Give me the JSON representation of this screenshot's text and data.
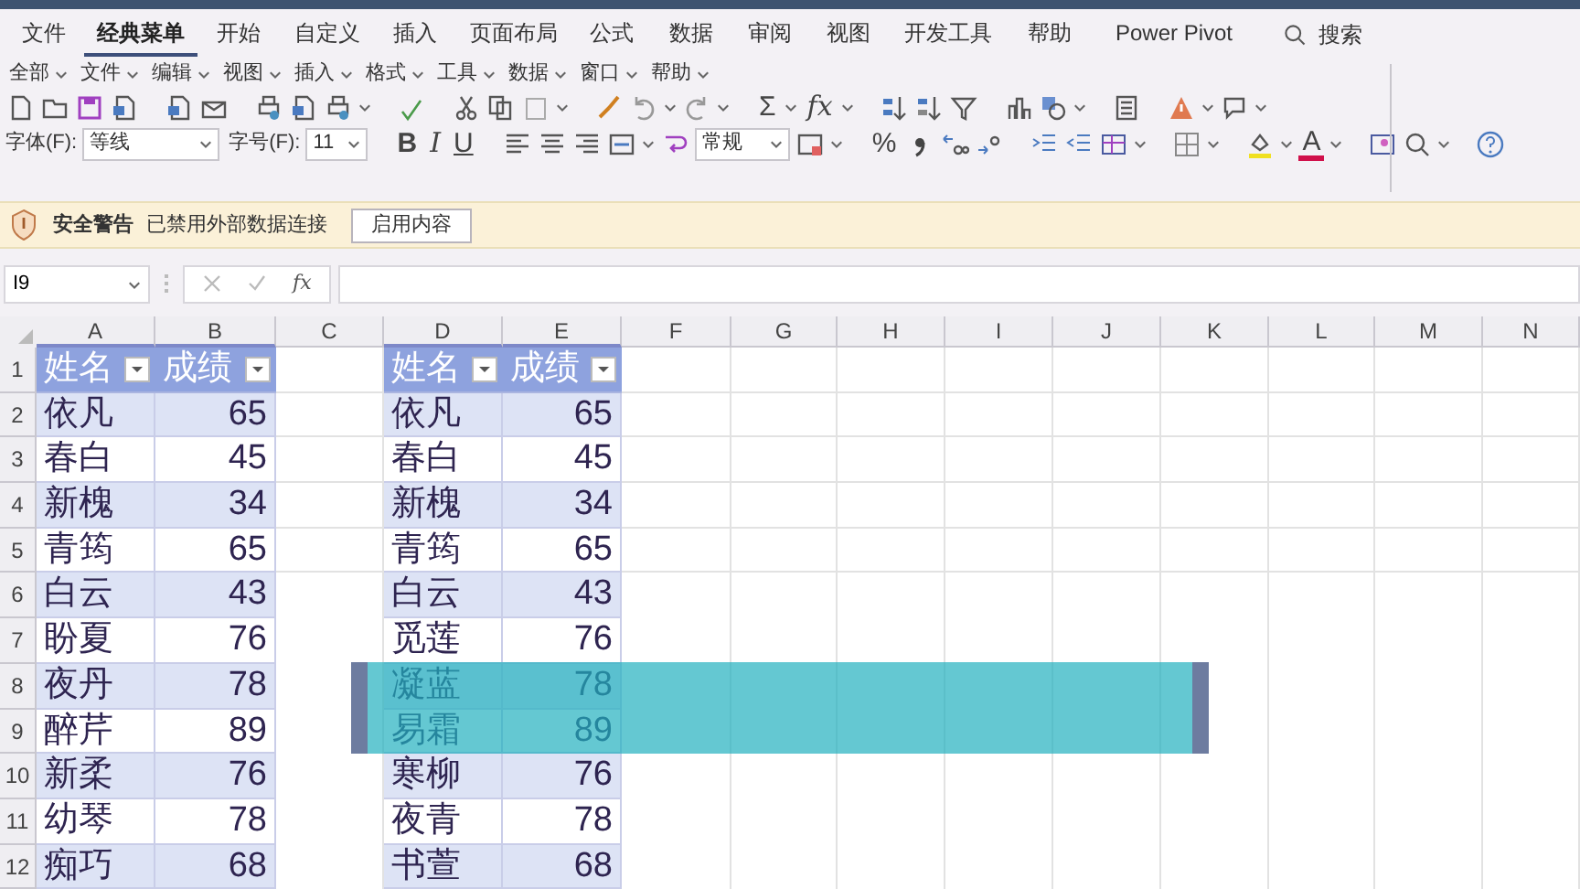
{
  "ribbon_tabs": [
    {
      "label": "文件",
      "selected": false
    },
    {
      "label": "经典菜单",
      "selected": true
    },
    {
      "label": "开始",
      "selected": false
    },
    {
      "label": "自定义",
      "selected": false
    },
    {
      "label": "插入",
      "selected": false
    },
    {
      "label": "页面布局",
      "selected": false
    },
    {
      "label": "公式",
      "selected": false
    },
    {
      "label": "数据",
      "selected": false
    },
    {
      "label": "审阅",
      "selected": false
    },
    {
      "label": "视图",
      "selected": false
    },
    {
      "label": "开发工具",
      "selected": false
    },
    {
      "label": "帮助",
      "selected": false
    },
    {
      "label": "Power Pivot",
      "selected": false
    }
  ],
  "search": {
    "label": "搜索"
  },
  "classic_menu": [
    "全部",
    "文件",
    "编辑",
    "视图",
    "插入",
    "格式",
    "工具",
    "数据",
    "窗口",
    "帮助"
  ],
  "toolbar_texts": {
    "sum": "Σ",
    "function": "fx",
    "bold": "B",
    "italic": "I",
    "underline": "U",
    "percent": "%",
    "font_color": "A"
  },
  "font_row": {
    "font_label": "字体(F):",
    "font": "等线",
    "size_label": "字号(F):",
    "size": "11",
    "number_format": "常规"
  },
  "security_bar": {
    "title": "安全警告",
    "message": "已禁用外部数据连接",
    "button": "启用内容"
  },
  "formula_bar": {
    "name_box": "I9",
    "fx": "fx"
  },
  "sheet": {
    "columns": [
      "A",
      "B",
      "C",
      "D",
      "E",
      "F",
      "G",
      "H",
      "I",
      "J",
      "K",
      "L",
      "M",
      "N"
    ],
    "row_numbers": [
      "1",
      "2",
      "3",
      "4",
      "5",
      "6",
      "7",
      "8",
      "9",
      "10",
      "11",
      "12"
    ]
  },
  "tables": [
    {
      "header": [
        "姓名",
        "成绩"
      ],
      "rows": [
        [
          "依凡",
          "65"
        ],
        [
          "春白",
          "45"
        ],
        [
          "新槐",
          "34"
        ],
        [
          "青筠",
          "65"
        ],
        [
          "白云",
          "43"
        ],
        [
          "盼夏",
          "76"
        ],
        [
          "夜丹",
          "78"
        ],
        [
          "醉芹",
          "89"
        ],
        [
          "新柔",
          "76"
        ],
        [
          "幼琴",
          "78"
        ],
        [
          "痴巧",
          "68"
        ]
      ]
    },
    {
      "header": [
        "姓名",
        "成绩"
      ],
      "rows": [
        [
          "依凡",
          "65"
        ],
        [
          "春白",
          "45"
        ],
        [
          "新槐",
          "34"
        ],
        [
          "青筠",
          "65"
        ],
        [
          "白云",
          "43"
        ],
        [
          "觅莲",
          "76"
        ],
        [
          "凝蓝",
          "78"
        ],
        [
          "易霜",
          "89"
        ],
        [
          "寒柳",
          "76"
        ],
        [
          "夜青",
          "78"
        ],
        [
          "书萱",
          "68"
        ]
      ]
    }
  ]
}
